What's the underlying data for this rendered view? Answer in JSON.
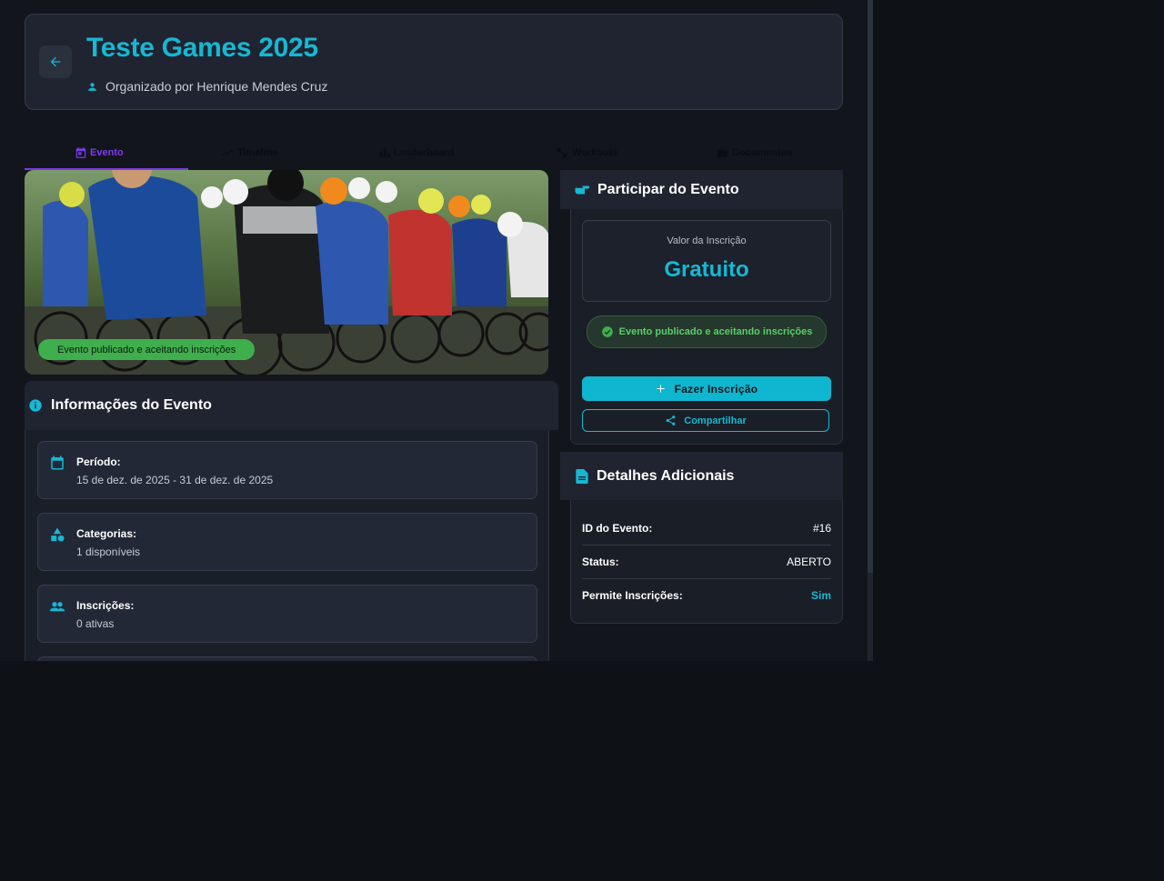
{
  "header": {
    "title": "Teste Games 2025",
    "organizer": "Organizado por Henrique Mendes Cruz"
  },
  "tabs": [
    {
      "label": "Evento",
      "icon": "calendar-icon",
      "active": true
    },
    {
      "label": "Timeline",
      "icon": "trending-icon",
      "active": false
    },
    {
      "label": "Leaderboard",
      "icon": "bar-chart-icon",
      "active": false
    },
    {
      "label": "Workouts",
      "icon": "fitness-icon",
      "active": false
    },
    {
      "label": "Documentos",
      "icon": "folder-icon",
      "active": false
    }
  ],
  "hero": {
    "badge": "Evento publicado e aceitando inscrições"
  },
  "info": {
    "title": "Informações do Evento",
    "items": [
      {
        "label": "Período:",
        "value": "15 de dez. de 2025 - 31 de dez. de 2025",
        "icon": "calendar-icon"
      },
      {
        "label": "Categorias:",
        "value": "1 disponíveis",
        "icon": "category-icon"
      },
      {
        "label": "Inscrições:",
        "value": "0 ativas",
        "icon": "people-icon"
      }
    ]
  },
  "join": {
    "title": "Participar do Evento",
    "price_label": "Valor da Inscrição",
    "price_value": "Gratuito",
    "status": "Evento publicado e aceitando inscrições",
    "register_button": "Fazer Inscrição",
    "share_button": "Compartilhar"
  },
  "details": {
    "title": "Detalhes Adicionais",
    "rows": [
      {
        "key": "ID do Evento:",
        "value": "#16"
      },
      {
        "key": "Status:",
        "value": "ABERTO"
      },
      {
        "key": "Permite Inscrições:",
        "value": "Sim"
      }
    ]
  },
  "colors": {
    "accent": "#16b8d3",
    "tab_active": "#7c3aed",
    "success": "#3fae4d",
    "background": "#12161c",
    "card": "#1f2430"
  }
}
